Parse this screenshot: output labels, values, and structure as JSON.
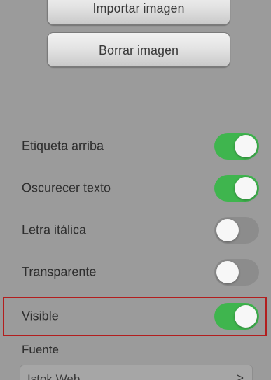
{
  "buttons": {
    "import_label": "Importar imagen",
    "delete_label": "Borrar imagen"
  },
  "settings": [
    {
      "label": "Etiqueta arriba",
      "on": true
    },
    {
      "label": "Oscurecer texto",
      "on": true
    },
    {
      "label": "Letra itálica",
      "on": false
    },
    {
      "label": "Transparente",
      "on": false
    },
    {
      "label": "Visible",
      "on": true
    }
  ],
  "font": {
    "section_label": "Fuente",
    "selected": "Istok Web",
    "chevron": ">"
  },
  "colors": {
    "toggle_on": "#3fb54e",
    "toggle_off": "#8c8c8c",
    "highlight": "#b21e1e"
  }
}
